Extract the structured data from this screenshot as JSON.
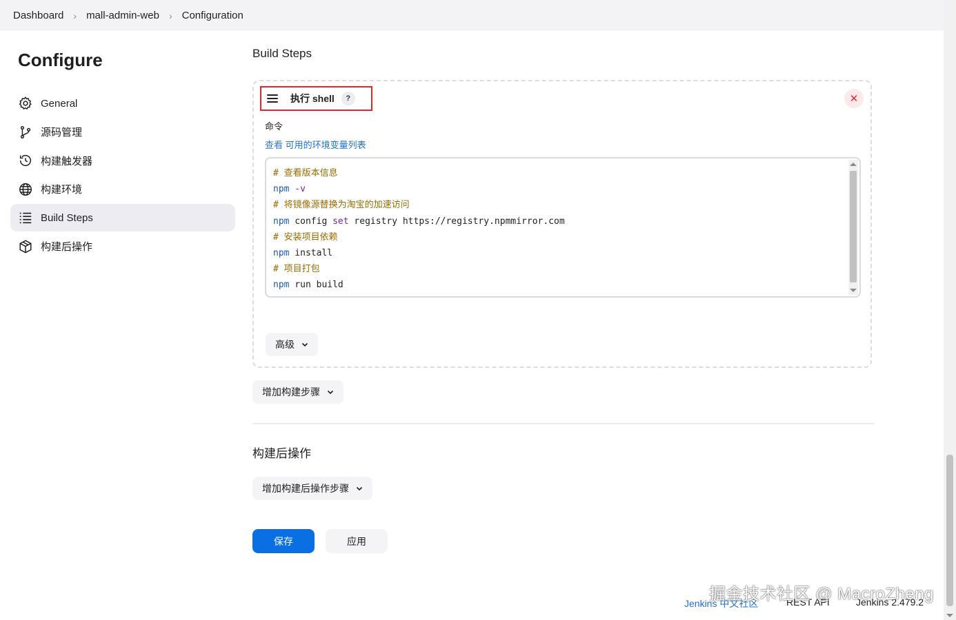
{
  "breadcrumb": [
    {
      "label": "Dashboard"
    },
    {
      "label": "mall-admin-web"
    },
    {
      "label": "Configuration"
    }
  ],
  "breadcrumb_separator": "›",
  "page_title": "Configure",
  "sidebar": {
    "items": [
      {
        "label": "General",
        "icon": "gear-icon"
      },
      {
        "label": "源码管理",
        "icon": "branch-icon"
      },
      {
        "label": "构建触发器",
        "icon": "clock-icon"
      },
      {
        "label": "构建环境",
        "icon": "globe-icon"
      },
      {
        "label": "Build Steps",
        "icon": "list-icon",
        "active": true
      },
      {
        "label": "构建后操作",
        "icon": "package-icon"
      }
    ]
  },
  "build_steps": {
    "section_title": "Build Steps",
    "step": {
      "title": "执行 shell",
      "help_label": "?",
      "close_label": "✕",
      "command_label": "命令",
      "env_link_prefix": "查看",
      "env_link": "可用的环境变量列表",
      "code_lines": [
        {
          "parts": [
            {
              "t": "# 查看版本信息",
              "c": "cmt"
            }
          ]
        },
        {
          "parts": [
            {
              "t": "npm",
              "c": "kw"
            },
            {
              "t": " -v",
              "c": "kw2"
            }
          ]
        },
        {
          "parts": [
            {
              "t": "# 将镜像源替换为淘宝的加速访问",
              "c": "cmt"
            }
          ]
        },
        {
          "parts": [
            {
              "t": "npm",
              "c": "kw"
            },
            {
              "t": " config ",
              "c": "arg"
            },
            {
              "t": "set",
              "c": "kw2"
            },
            {
              "t": " registry https://registry.npmmirror.com",
              "c": "arg"
            }
          ]
        },
        {
          "parts": [
            {
              "t": "# 安装项目依赖",
              "c": "cmt"
            }
          ]
        },
        {
          "parts": [
            {
              "t": "npm",
              "c": "kw"
            },
            {
              "t": " install",
              "c": "arg"
            }
          ]
        },
        {
          "parts": [
            {
              "t": "# 项目打包",
              "c": "cmt"
            }
          ]
        },
        {
          "parts": [
            {
              "t": "npm",
              "c": "kw"
            },
            {
              "t": " run build",
              "c": "arg"
            }
          ]
        }
      ],
      "advanced_label": "高级"
    },
    "add_step_label": "增加构建步骤"
  },
  "post_build": {
    "section_title": "构建后操作",
    "add_label": "增加构建后操作步骤"
  },
  "actions": {
    "save_label": "保存",
    "apply_label": "应用"
  },
  "footer": {
    "community_link": "Jenkins 中文社区",
    "rest_api": "REST API",
    "version": "Jenkins 2.479.2"
  },
  "watermark": "掘金技术社区 @ MacroZheng",
  "colors": {
    "accent": "#0b6fe4",
    "link": "#1f6fd2",
    "highlight_border": "#e0242a",
    "close_bg": "#fde8ea",
    "close_fg": "#d52a34",
    "active_sidebar_bg": "#ececf1"
  }
}
